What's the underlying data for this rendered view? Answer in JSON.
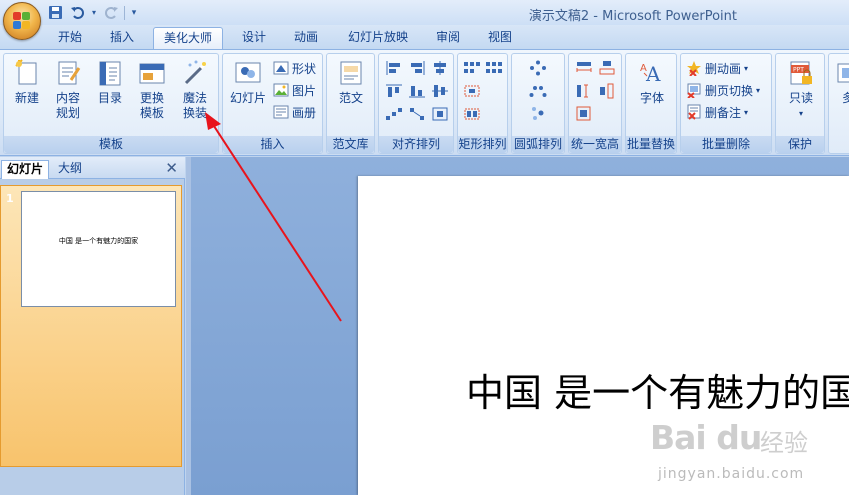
{
  "window": {
    "title": "演示文稿2 - Microsoft PowerPoint"
  },
  "quick_access": {
    "icons": [
      "save-icon",
      "undo-icon",
      "redo-icon",
      "customize-icon"
    ]
  },
  "tabs": [
    {
      "label": "开始"
    },
    {
      "label": "插入"
    },
    {
      "label": "美化大师",
      "active": true
    },
    {
      "label": "设计"
    },
    {
      "label": "动画"
    },
    {
      "label": "幻灯片放映"
    },
    {
      "label": "审阅"
    },
    {
      "label": "视图"
    }
  ],
  "ribbon": {
    "group_template": {
      "label": "模板",
      "new": "新建",
      "content_plan_1": "内容",
      "content_plan_2": "规划",
      "toc": "目录",
      "change_tpl_1": "更换",
      "change_tpl_2": "模板",
      "magic_1": "魔法",
      "magic_2": "换装"
    },
    "group_insert": {
      "label": "插入",
      "slide": "幻灯片",
      "shape": "形状",
      "picture": "图片",
      "album": "画册"
    },
    "group_library": {
      "label": "范文库",
      "sample": "范文"
    },
    "group_align": {
      "label": "对齐排列"
    },
    "group_rect": {
      "label": "矩形排列"
    },
    "group_arc": {
      "label": "圆弧排列"
    },
    "group_unify": {
      "label": "统一宽高"
    },
    "group_replace": {
      "label": "批量替换",
      "font": "字体"
    },
    "group_delete": {
      "label": "批量删除",
      "del_anim": "删动画",
      "del_trans": "删页切换",
      "del_notes": "删备注"
    },
    "group_protect": {
      "label": "保护",
      "readonly": "只读",
      "more": "多"
    }
  },
  "pane": {
    "tab_slides": "幻灯片",
    "tab_outline": "大纲",
    "close": "✕",
    "slide_number": "1",
    "thumb_text": "中国 是一个有魅力的国家"
  },
  "slide": {
    "text": "中国 是一个有魅力的国"
  },
  "watermark": {
    "logo": "Bai du",
    "cn": "经验",
    "url": "jingyan.baidu.com"
  },
  "colors": {
    "accent": "#15428b",
    "arrow": "#e8141c",
    "selection": "#f8c36c"
  }
}
